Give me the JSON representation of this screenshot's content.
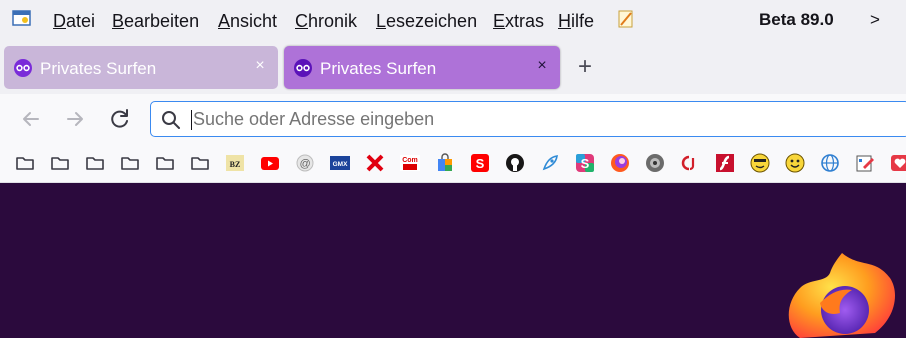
{
  "menubar": {
    "items": [
      {
        "underline": "D",
        "rest": "atei"
      },
      {
        "underline": "B",
        "rest": "earbeiten"
      },
      {
        "underline": "A",
        "rest": "nsicht"
      },
      {
        "underline": "C",
        "rest": "hronik"
      },
      {
        "underline": "L",
        "rest": "esezeichen"
      },
      {
        "underline": "E",
        "rest": "xtras"
      },
      {
        "underline": "H",
        "rest": "ilfe"
      }
    ],
    "version": "Beta 89.0",
    "overflow": ">"
  },
  "tabs": [
    {
      "title": "Privates Surfen",
      "close": "×"
    },
    {
      "title": "Privates Surfen",
      "close": "×"
    }
  ],
  "newtab": "+",
  "urlbar": {
    "placeholder": "Suche oder Adresse eingeben"
  },
  "bookmarks": {
    "icons": [
      "folder-icon",
      "folder-icon",
      "folder-icon",
      "folder-icon",
      "folder-icon",
      "folder-icon",
      "bz-icon",
      "youtube-icon",
      "at-icon",
      "gmx-icon",
      "x-icon",
      "com-icon",
      "shopping-bag-icon",
      "sparkasse-icon",
      "github-icon",
      "rocket-icon",
      "s-icon",
      "orb-icon",
      "disc-icon",
      "cjs-icon",
      "flash-icon",
      "smiley-icon",
      "smiley-icon",
      "globe-icon",
      "edit-icon",
      "heart-icon"
    ],
    "labels": {
      "bz": "BZ",
      "gmx": "GMX",
      "com": "Com",
      "sparkasse": "S",
      "s": "S",
      "x": "X"
    }
  },
  "colors": {
    "accent": "#3b8af0",
    "private_purple": "#7a2bd9",
    "content_bg": "#2b0a3d"
  }
}
